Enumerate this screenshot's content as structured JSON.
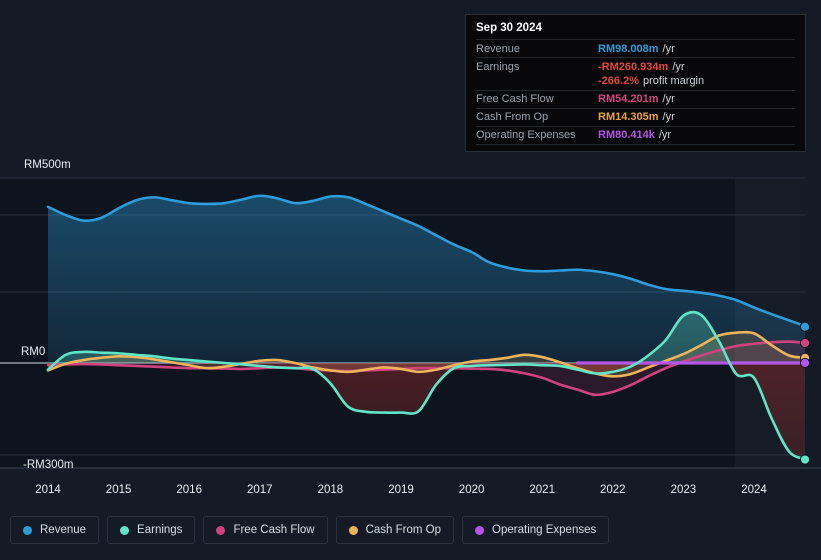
{
  "tooltip": {
    "date": "Sep 30 2024",
    "rows": [
      {
        "key": "Revenue",
        "value": "RM98.008m",
        "unit": "/yr",
        "color": "#2d9cdb"
      },
      {
        "key": "Earnings",
        "value": "-RM260.934m",
        "unit": "/yr",
        "color": "#e2483c"
      },
      {
        "key": "",
        "value": "-266.2%",
        "unit": "profit margin",
        "color": "#e2483c"
      },
      {
        "key": "Free Cash Flow",
        "value": "RM54.201m",
        "unit": "/yr",
        "color": "#d1437f"
      },
      {
        "key": "Cash From Op",
        "value": "RM14.305m",
        "unit": "/yr",
        "color": "#e8a33d"
      },
      {
        "key": "Operating Expenses",
        "value": "RM80.414k",
        "unit": "/yr",
        "color": "#b455e8"
      }
    ]
  },
  "legend": [
    {
      "label": "Revenue",
      "color": "#2d9cdb"
    },
    {
      "label": "Earnings",
      "color": "#5fe6c8"
    },
    {
      "label": "Free Cash Flow",
      "color": "#d1437f"
    },
    {
      "label": "Cash From Op",
      "color": "#efb35c"
    },
    {
      "label": "Operating Expenses",
      "color": "#b455e8"
    }
  ],
  "axis": {
    "y_ticks": [
      {
        "label": "RM500m",
        "value": 500
      },
      {
        "label": "RM0",
        "value": 0
      },
      {
        "label": "-RM300m",
        "value": -300
      }
    ],
    "x_ticks": [
      "2014",
      "2015",
      "2016",
      "2017",
      "2018",
      "2019",
      "2020",
      "2021",
      "2022",
      "2023",
      "2024"
    ]
  },
  "chart_data": {
    "type": "area",
    "title": "",
    "xlabel": "",
    "ylabel": "",
    "ylim": [
      -300,
      500
    ],
    "xlim": [
      2014,
      2024.75
    ],
    "grid": true,
    "legend_position": "bottom",
    "currency": "RM",
    "units": "millions",
    "x": [
      2014.0,
      2014.25,
      2014.5,
      2014.75,
      2015.0,
      2015.25,
      2015.5,
      2015.75,
      2016.0,
      2016.25,
      2016.5,
      2016.75,
      2017.0,
      2017.25,
      2017.5,
      2017.75,
      2018.0,
      2018.25,
      2018.5,
      2018.75,
      2019.0,
      2019.25,
      2019.5,
      2019.75,
      2020.0,
      2020.25,
      2020.5,
      2020.75,
      2021.0,
      2021.25,
      2021.5,
      2021.75,
      2022.0,
      2022.25,
      2022.5,
      2022.75,
      2023.0,
      2023.25,
      2023.5,
      2023.75,
      2024.0,
      2024.25,
      2024.5,
      2024.75
    ],
    "series": [
      {
        "name": "Revenue",
        "color": "#2d9cdb",
        "values": [
          422,
          400,
          385,
          392,
          418,
          440,
          448,
          440,
          432,
          430,
          432,
          442,
          452,
          445,
          432,
          438,
          450,
          448,
          430,
          410,
          390,
          370,
          345,
          320,
          300,
          272,
          258,
          250,
          248,
          250,
          252,
          248,
          240,
          228,
          212,
          200,
          195,
          190,
          182,
          170,
          150,
          132,
          115,
          98
        ]
      },
      {
        "name": "Earnings",
        "color": "#5fe6c8",
        "values": [
          -18,
          22,
          30,
          28,
          26,
          22,
          18,
          12,
          8,
          4,
          0,
          -4,
          -8,
          -12,
          -14,
          -16,
          -55,
          -118,
          -132,
          -134,
          -134,
          -130,
          -58,
          -14,
          -8,
          -6,
          -5,
          -4,
          -6,
          -8,
          -18,
          -28,
          -24,
          -10,
          20,
          62,
          128,
          130,
          60,
          -30,
          -40,
          -150,
          -240,
          -261
        ]
      },
      {
        "name": "Free Cash Flow",
        "color": "#d1437f",
        "values": [
          -6,
          -4,
          -3,
          -4,
          -6,
          -8,
          -10,
          -12,
          -14,
          -14,
          -15,
          -16,
          -14,
          -12,
          -14,
          -18,
          -20,
          -22,
          -20,
          -18,
          -16,
          -14,
          -14,
          -14,
          -15,
          -16,
          -20,
          -28,
          -40,
          -58,
          -72,
          -86,
          -78,
          -60,
          -36,
          -14,
          4,
          20,
          34,
          46,
          52,
          56,
          58,
          54
        ]
      },
      {
        "name": "Cash From Op",
        "color": "#efb35c",
        "values": [
          -20,
          -2,
          8,
          14,
          18,
          16,
          10,
          2,
          -6,
          -14,
          -10,
          -2,
          6,
          8,
          0,
          -12,
          -20,
          -24,
          -18,
          -12,
          -16,
          -24,
          -18,
          -6,
          4,
          8,
          14,
          22,
          16,
          2,
          -14,
          -28,
          -36,
          -30,
          -12,
          6,
          24,
          48,
          74,
          82,
          80,
          48,
          20,
          14
        ]
      },
      {
        "name": "Operating Expenses",
        "color": "#b455e8",
        "values": [
          null,
          null,
          null,
          null,
          null,
          null,
          null,
          null,
          null,
          null,
          null,
          null,
          null,
          null,
          null,
          null,
          null,
          null,
          null,
          null,
          null,
          null,
          null,
          null,
          null,
          null,
          null,
          null,
          null,
          null,
          0.1,
          0.1,
          0.1,
          0.1,
          0.1,
          0.1,
          0.1,
          0.1,
          0.1,
          0.1,
          0.1,
          0.1,
          0.1,
          0.08
        ]
      }
    ],
    "annotations": [
      {
        "type": "forecast-band",
        "from": 2023.75,
        "to": 2024.75
      },
      {
        "type": "end-markers",
        "at": 2024.75
      }
    ]
  }
}
